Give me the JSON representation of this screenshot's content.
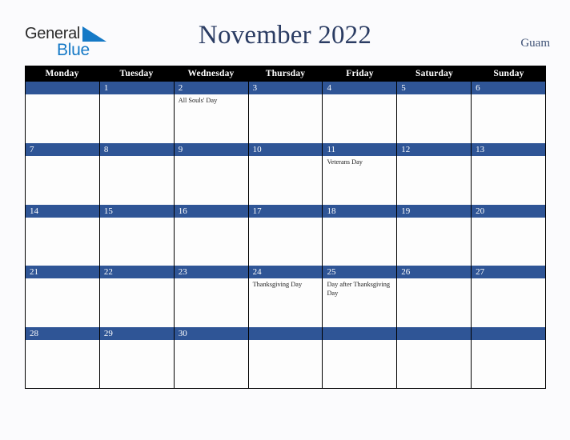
{
  "brand": {
    "name_top": "General",
    "name_bottom": "Blue",
    "triangle_color": "#1579c6",
    "top_color": "#2b2b2b"
  },
  "header": {
    "title": "November 2022",
    "locale": "Guam",
    "title_color": "#2b3c63"
  },
  "calendar": {
    "accent_color": "#2f5596",
    "header_bg": "#000000",
    "weekdays": [
      "Monday",
      "Tuesday",
      "Wednesday",
      "Thursday",
      "Friday",
      "Saturday",
      "Sunday"
    ],
    "weeks": [
      [
        {
          "day": "",
          "event": ""
        },
        {
          "day": "1",
          "event": ""
        },
        {
          "day": "2",
          "event": "All Souls' Day"
        },
        {
          "day": "3",
          "event": ""
        },
        {
          "day": "4",
          "event": ""
        },
        {
          "day": "5",
          "event": ""
        },
        {
          "day": "6",
          "event": ""
        }
      ],
      [
        {
          "day": "7",
          "event": ""
        },
        {
          "day": "8",
          "event": ""
        },
        {
          "day": "9",
          "event": ""
        },
        {
          "day": "10",
          "event": ""
        },
        {
          "day": "11",
          "event": "Veterans Day"
        },
        {
          "day": "12",
          "event": ""
        },
        {
          "day": "13",
          "event": ""
        }
      ],
      [
        {
          "day": "14",
          "event": ""
        },
        {
          "day": "15",
          "event": ""
        },
        {
          "day": "16",
          "event": ""
        },
        {
          "day": "17",
          "event": ""
        },
        {
          "day": "18",
          "event": ""
        },
        {
          "day": "19",
          "event": ""
        },
        {
          "day": "20",
          "event": ""
        }
      ],
      [
        {
          "day": "21",
          "event": ""
        },
        {
          "day": "22",
          "event": ""
        },
        {
          "day": "23",
          "event": ""
        },
        {
          "day": "24",
          "event": "Thanksgiving Day"
        },
        {
          "day": "25",
          "event": "Day after Thanksgiving Day"
        },
        {
          "day": "26",
          "event": ""
        },
        {
          "day": "27",
          "event": ""
        }
      ],
      [
        {
          "day": "28",
          "event": ""
        },
        {
          "day": "29",
          "event": ""
        },
        {
          "day": "30",
          "event": ""
        },
        {
          "day": "",
          "event": ""
        },
        {
          "day": "",
          "event": ""
        },
        {
          "day": "",
          "event": ""
        },
        {
          "day": "",
          "event": ""
        }
      ]
    ]
  }
}
